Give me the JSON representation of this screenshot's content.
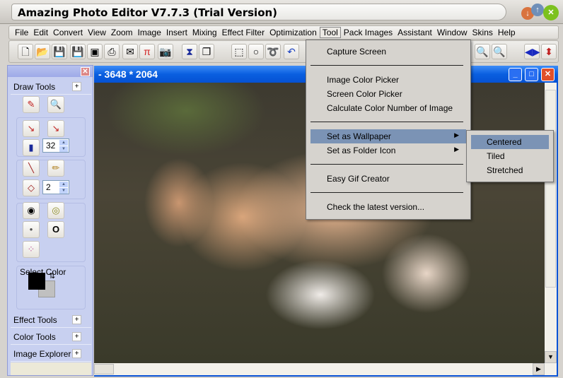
{
  "window": {
    "title": "Amazing Photo Editor V7.7.3 (Trial Version)"
  },
  "menubar": [
    "File",
    "Edit",
    "Convert",
    "View",
    "Zoom",
    "Image",
    "Insert",
    "Mixing",
    "Effect Filter",
    "Optimization",
    "Tool",
    "Pack Images",
    "Assistant",
    "Window",
    "Skins",
    "Help"
  ],
  "tool_menu": {
    "items": [
      "Capture Screen",
      "Image Color Picker",
      "Screen Color Picker",
      "Calculate Color Number of Image",
      "Set as Wallpaper",
      "Set as Folder Icon",
      "Easy Gif Creator",
      "Check the latest version..."
    ]
  },
  "wallpaper_submenu": {
    "items": [
      "Centered",
      "Tiled",
      "Stretched"
    ],
    "highlighted": "Centered"
  },
  "panel": {
    "draw_tools": "Draw Tools",
    "spray_size": "32",
    "pen_size": "2",
    "select_color": "Select Color",
    "effect_tools": "Effect Tools",
    "color_tools": "Color Tools",
    "image_explorer": "Image Explorer",
    "plus": "+",
    "foreground": "#000000",
    "background": "#c0c0c0"
  },
  "document": {
    "title": "- 3648 * 2064"
  }
}
